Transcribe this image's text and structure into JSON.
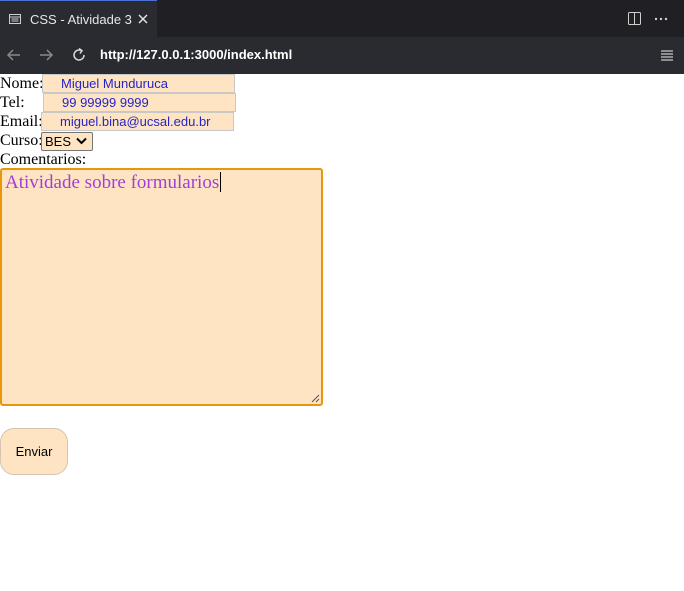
{
  "tab": {
    "title": "CSS - Atividade 3"
  },
  "browser": {
    "url": "http://127.0.0.1:3000/index.html"
  },
  "icons": {
    "page": "page-icon",
    "close": "close-icon",
    "split": "split-editor-icon",
    "more": "more-icon",
    "back": "back-arrow-icon",
    "forward": "forward-arrow-icon",
    "reload": "reload-icon",
    "menu": "menu-icon"
  },
  "form": {
    "nome": {
      "label": "Nome:",
      "value": "Miguel Munduruca"
    },
    "tel": {
      "label": "Tel:",
      "value": "99 99999 9999"
    },
    "email": {
      "label": "Email:",
      "value": "miguel.bina@ucsal.edu.br"
    },
    "curso": {
      "label": "Curso:",
      "selected": "BES"
    },
    "comentarios": {
      "label": "Comentarios:",
      "value": "Atividade sobre formularios"
    },
    "submit_label": "Enviar"
  },
  "colors": {
    "field_bg": "#ffe4c4",
    "field_text": "#2424c8",
    "textarea_text": "#a03ed8",
    "textarea_border": "#e8960c",
    "chrome_dark": "#1f1f24"
  }
}
